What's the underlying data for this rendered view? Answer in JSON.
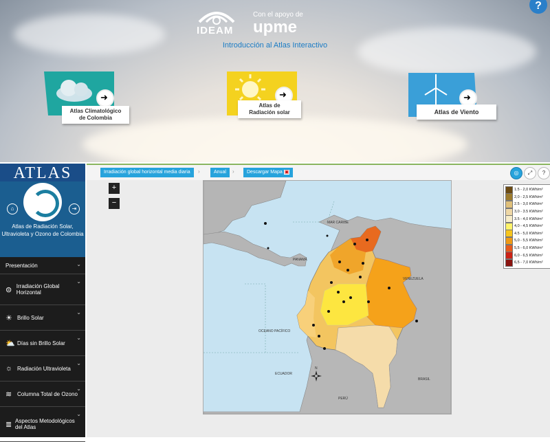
{
  "banner": {
    "ideam": "IDEAM",
    "support_text": "Con el apoyo de",
    "upme": "upme",
    "intro": "Introducción al Atlas Interactivo",
    "help": "?",
    "cards": [
      {
        "label_line1": "Atlas Climatológico",
        "label_line2": "de Colombia",
        "icon": "cloud-icon",
        "color": "#1fa6a0"
      },
      {
        "label_line1": "Atlas de",
        "label_line2": "Radiación solar",
        "icon": "sun-icon",
        "color": "#f4d21f"
      },
      {
        "label_line1": "Atlas de Viento",
        "label_line2": "",
        "icon": "wind-turbine-icon",
        "color": "#3a9fd8"
      }
    ]
  },
  "sidebar": {
    "brand": "ATLAS",
    "title": "Atlas de Radiación Solar, Ultravioleta y Ozono de Colombia",
    "items": [
      {
        "label": "Presentación",
        "icon": ""
      },
      {
        "label": "Irradiación Global Horizontal",
        "icon": "globe-icon"
      },
      {
        "label": "Brillo Solar",
        "icon": "sun-icon"
      },
      {
        "label": "Días sin Brillo Solar",
        "icon": "cloud-sun-icon"
      },
      {
        "label": "Radiación Ultravioleta",
        "icon": "uv-sun-icon"
      },
      {
        "label": "Columna Total de Ozono",
        "icon": "ozone-icon"
      },
      {
        "label": "Aspectos Metodológicos del Atlas",
        "icon": "list-icon"
      }
    ]
  },
  "toolbar": {
    "crumb1": "Irradiación global horizontal media diaria",
    "crumb2": "Anual",
    "crumb3": "Descargar Mapa",
    "zoom_in": "+",
    "zoom_out": "−",
    "help": "?"
  },
  "map": {
    "labels": {
      "caribe": "MAR CARIBE",
      "panama": "PANAMÁ",
      "venezuela": "VENEZUELA",
      "pacifico": "OCEANO PACÍFICO",
      "ecuador": "ECUADOR",
      "brasil": "BRASIL",
      "peru": "PERÚ",
      "north": "N"
    }
  },
  "legend": [
    {
      "label": "1.5 - 2,0 KWh/m²",
      "color": "#6b4a12"
    },
    {
      "label": "2,0 - 2,5 KWh/m²",
      "color": "#9d7b2c"
    },
    {
      "label": "2.5 - 3,0 KWh/m²",
      "color": "#e0c07a"
    },
    {
      "label": "3,0 - 3.5 KWh/m²",
      "color": "#efd8a6"
    },
    {
      "label": "3.5 - 4,0 KWh/m²",
      "color": "#f7ecc8"
    },
    {
      "label": "4,0 - 4,5 KWh/m²",
      "color": "#fff36a"
    },
    {
      "label": "4.5 - 5,0 KWh/m²",
      "color": "#f7c51d"
    },
    {
      "label": "5,0 - 5,5 KWh/m²",
      "color": "#ef9a15"
    },
    {
      "label": "5,5 - 6,0 KWh/m²",
      "color": "#e65a1c"
    },
    {
      "label": "6,0 - 6,5 KWh/m²",
      "color": "#cc2216"
    },
    {
      "label": "6,5 - 7,0 KWh/m²",
      "color": "#8a1410"
    }
  ]
}
